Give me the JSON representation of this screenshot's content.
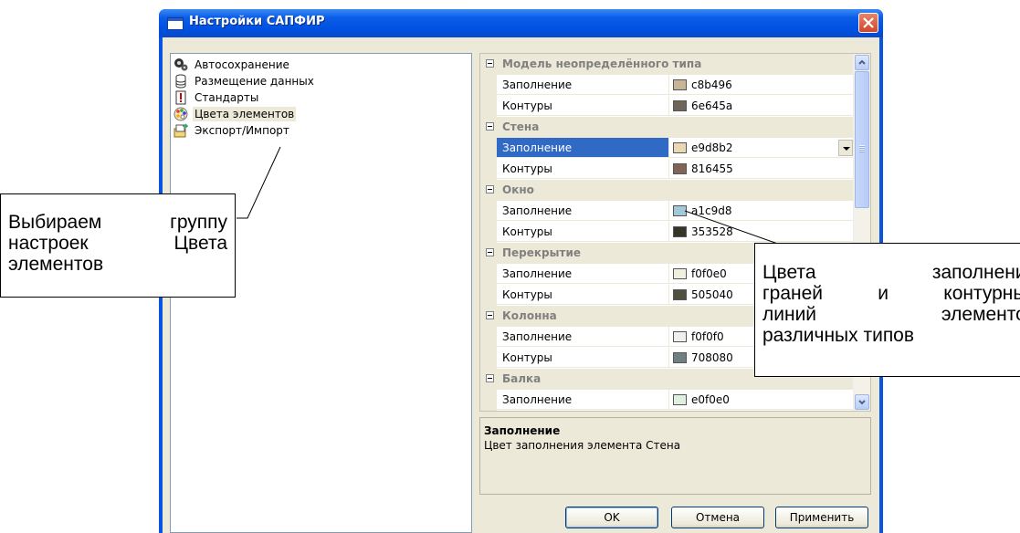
{
  "window": {
    "title": "Настройки САПФИР"
  },
  "tree": {
    "items": [
      {
        "label": "Автосохранение",
        "icon": "gears-icon",
        "selected": false
      },
      {
        "label": "Размещение данных",
        "icon": "database-icon",
        "selected": false
      },
      {
        "label": "Стандарты",
        "icon": "warning-doc-icon",
        "selected": false
      },
      {
        "label": "Цвета элементов",
        "icon": "palette-icon",
        "selected": true
      },
      {
        "label": "Экспорт/Импорт",
        "icon": "export-import-icon",
        "selected": false
      }
    ]
  },
  "grid": {
    "categories": [
      {
        "name": "Модель неопределённого типа",
        "props": [
          {
            "name": "Заполнение",
            "value": "c8b496",
            "color": "#c8b496"
          },
          {
            "name": "Контуры",
            "value": "6e645a",
            "color": "#6e645a"
          }
        ]
      },
      {
        "name": "Стена",
        "props": [
          {
            "name": "Заполнение",
            "value": "e9d8b2",
            "color": "#e9d8b2",
            "selected": true
          },
          {
            "name": "Контуры",
            "value": "816455",
            "color": "#816455"
          }
        ]
      },
      {
        "name": "Окно",
        "props": [
          {
            "name": "Заполнение",
            "value": "a1c9d8",
            "color": "#a1c9d8"
          },
          {
            "name": "Контуры",
            "value": "353528",
            "color": "#353528"
          }
        ]
      },
      {
        "name": "Перекрытие",
        "props": [
          {
            "name": "Заполнение",
            "value": "f0f0e0",
            "color": "#f0f0e0"
          },
          {
            "name": "Контуры",
            "value": "505040",
            "color": "#505040"
          }
        ]
      },
      {
        "name": "Колонна",
        "props": [
          {
            "name": "Заполнение",
            "value": "f0f0f0",
            "color": "#f0f0f0"
          },
          {
            "name": "Контуры",
            "value": "708080",
            "color": "#708080"
          }
        ]
      },
      {
        "name": "Балка",
        "props": [
          {
            "name": "Заполнение",
            "value": "e0f0e0",
            "color": "#e0f0e0"
          }
        ]
      }
    ]
  },
  "description": {
    "title": "Заполнение",
    "text": "Цвет заполнения элемента Стена"
  },
  "buttons": {
    "ok": "OK",
    "cancel": "Отмена",
    "apply": "Применить"
  },
  "callouts": {
    "left": [
      "Выбираем группу",
      "настроек Цвета",
      "элементов"
    ],
    "right": [
      "Цвета заполнения",
      "граней и контурных",
      "линий элементов",
      "различных типов"
    ]
  }
}
